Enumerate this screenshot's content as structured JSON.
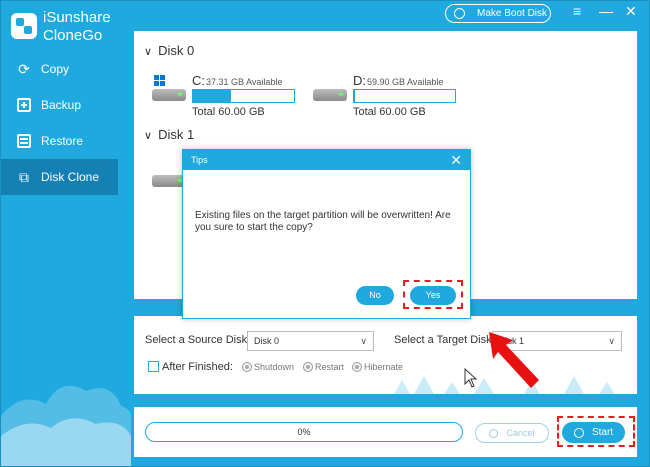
{
  "app": {
    "name": "iSunshare CloneGo",
    "name_line1": "iSunshare",
    "name_line2": "CloneGo",
    "accent": "#1fa9de"
  },
  "header": {
    "boot_button": "Make Boot Disk",
    "menu_icon": "≡",
    "minimize_icon": "—",
    "close_icon": "✕"
  },
  "sidebar": {
    "items": [
      {
        "label": "Copy",
        "icon": "refresh-icon",
        "active": false
      },
      {
        "label": "Backup",
        "icon": "plus-box-icon",
        "active": false
      },
      {
        "label": "Restore",
        "icon": "list-box-icon",
        "active": false
      },
      {
        "label": "Disk Clone",
        "icon": "clone-icon",
        "active": true
      }
    ]
  },
  "disks": [
    {
      "name": "Disk 0",
      "partitions": [
        {
          "letter": "C:",
          "available": "37.31 GB Available",
          "total": "Total 60.00 GB",
          "used_fraction": 0.38,
          "system": true
        },
        {
          "letter": "D:",
          "available": "59.90 GB Available",
          "total": "Total 60.00 GB",
          "used_fraction": 0.01,
          "system": false
        }
      ]
    },
    {
      "name": "Disk 1"
    }
  ],
  "options": {
    "source_label": "Select a Source Disk:",
    "source_value": "Disk 0",
    "target_label": "Select a Target Disk:",
    "target_value": "Disk 1",
    "after_label": "After Finished:",
    "radios": [
      "Shutdown",
      "Restart",
      "Hibernate"
    ]
  },
  "progress": {
    "text": "0%",
    "value": 0
  },
  "actions": {
    "cancel": "Cancel",
    "start": "Start"
  },
  "dialog": {
    "title": "Tips",
    "message": "Existing files on the target partition will be overwritten! Are you sure to start the copy?",
    "no": "No",
    "yes": "Yes"
  }
}
